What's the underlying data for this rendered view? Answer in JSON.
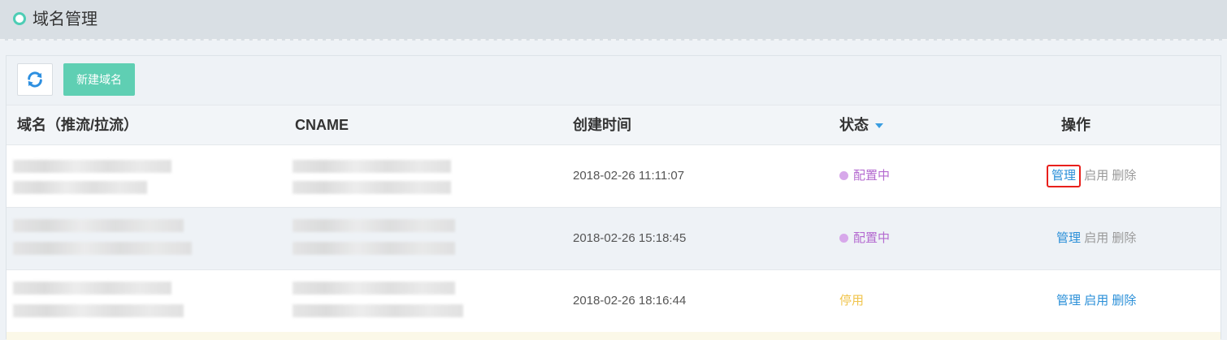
{
  "header": {
    "title": "域名管理",
    "dot_color": "#4ecdb5"
  },
  "toolbar": {
    "refresh_icon": "refresh-icon",
    "new_label": "新建域名"
  },
  "table": {
    "columns": [
      "域名（推流/拉流）",
      "CNAME",
      "创建时间",
      "状态",
      "操作"
    ],
    "rows": [
      {
        "created": "2018-02-26 11:11:07",
        "status": "配置中",
        "status_color": "#b46ad0",
        "dot_color": "#d7a8ea",
        "ops": [
          "管理",
          "启用",
          "删除"
        ]
      },
      {
        "created": "2018-02-26 15:18:45",
        "status": "配置中",
        "status_color": "#b46ad0",
        "dot_color": "#d7a8ea",
        "ops": [
          "管理",
          "启用",
          "删除"
        ]
      },
      {
        "created": "2018-02-26 18:16:44",
        "status": "停用",
        "status_color": "#f0c44c",
        "ops": [
          "管理",
          "启用",
          "删除"
        ]
      }
    ]
  }
}
